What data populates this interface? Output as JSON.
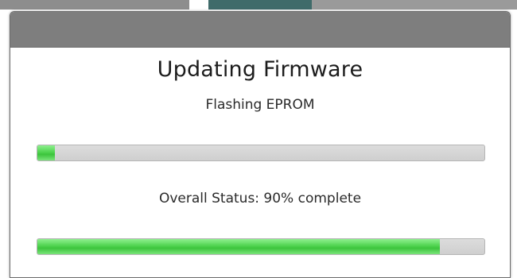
{
  "dialog": {
    "title": "Updating Firmware",
    "subtitle": "Flashing EPROM",
    "step_progress": 0.04,
    "overall_status": "Overall Status: 90% complete",
    "overall_progress": 0.9,
    "accent_color": "#4fd34f"
  }
}
